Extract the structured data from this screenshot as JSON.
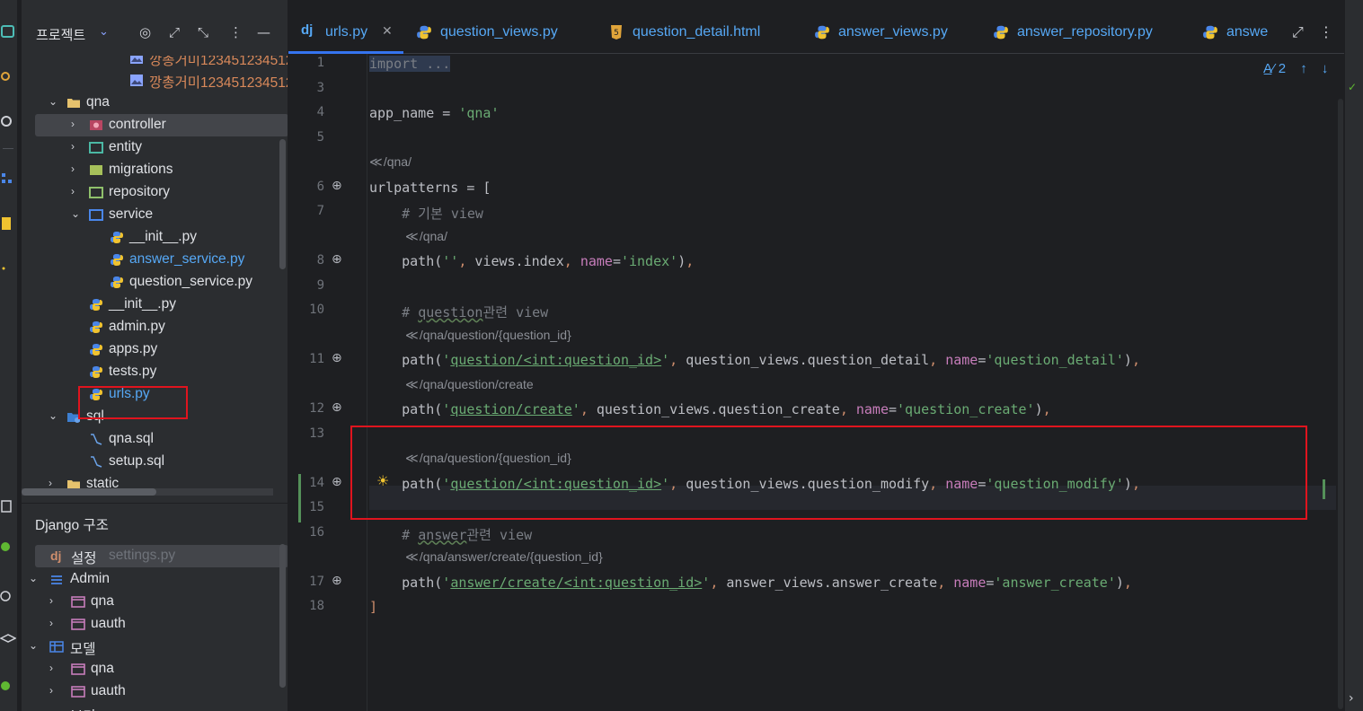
{
  "project_panel": {
    "title": "프로젝트",
    "tree": [
      {
        "label": "깡총거미1234512345123",
        "kind": "image",
        "depth": 4,
        "color": "#d9895a"
      },
      {
        "label": "깡총거미1234512345123",
        "kind": "image",
        "depth": 4,
        "color": "#d9895a"
      },
      {
        "label": "qna",
        "kind": "folder",
        "expanded": true
      },
      {
        "label": "controller",
        "kind": "package-controller",
        "expanded": false,
        "selected": true
      },
      {
        "label": "entity",
        "kind": "package-entity",
        "expanded": false
      },
      {
        "label": "migrations",
        "kind": "package-migrations",
        "expanded": false
      },
      {
        "label": "repository",
        "kind": "package-repository",
        "expanded": false
      },
      {
        "label": "service",
        "kind": "package-service",
        "expanded": true
      },
      {
        "label": "__init__.py",
        "kind": "python"
      },
      {
        "label": "answer_service.py",
        "kind": "python",
        "color": "#56a8f5"
      },
      {
        "label": "question_service.py",
        "kind": "python"
      },
      {
        "label": "__init__.py",
        "kind": "python"
      },
      {
        "label": "admin.py",
        "kind": "python"
      },
      {
        "label": "apps.py",
        "kind": "python"
      },
      {
        "label": "tests.py",
        "kind": "python"
      },
      {
        "label": "urls.py",
        "kind": "python",
        "color": "#56a8f5",
        "highlighted": true
      },
      {
        "label": "sql",
        "kind": "folder-sql",
        "expanded": true
      },
      {
        "label": "qna.sql",
        "kind": "sql"
      },
      {
        "label": "setup.sql",
        "kind": "sql"
      },
      {
        "label": "static",
        "kind": "folder",
        "expanded": false
      }
    ]
  },
  "django_panel": {
    "title": "Django 구조",
    "settings_label": "설정",
    "settings_file": "settings.py",
    "groups": [
      {
        "label": "Admin",
        "icon": "admin-icon",
        "items": [
          "qna",
          "uauth"
        ]
      },
      {
        "label": "모델",
        "icon": "table-icon",
        "items": [
          "qna",
          "uauth"
        ]
      }
    ],
    "bottom_item": "보기"
  },
  "tabs": [
    {
      "label": "urls.py",
      "icon": "dj",
      "active": true
    },
    {
      "label": "question_views.py",
      "icon": "python"
    },
    {
      "label": "question_detail.html",
      "icon": "html5"
    },
    {
      "label": "answer_views.py",
      "icon": "python"
    },
    {
      "label": "answer_repository.py",
      "icon": "python"
    },
    {
      "label": "answe",
      "icon": "python"
    }
  ],
  "inspection": {
    "count": "2"
  },
  "code_lines": [
    {
      "no": "1",
      "text": "import ...",
      "folded": true
    },
    {
      "no": "3",
      "text": ""
    },
    {
      "no": "4",
      "text": "app_name = 'qna'"
    },
    {
      "no": "5",
      "text": ""
    },
    {
      "hint": "/qna/"
    },
    {
      "no": "6",
      "text": "urlpatterns = [",
      "endpoint": true
    },
    {
      "no": "7",
      "text": "    # 기본 view"
    },
    {
      "hint": "/qna/"
    },
    {
      "no": "8",
      "text": "    path('', views.index, name='index'),",
      "endpoint": true
    },
    {
      "no": "9",
      "text": ""
    },
    {
      "no": "10",
      "text": "    # question관련 view"
    },
    {
      "hint": "/qna/question/{question_id}"
    },
    {
      "no": "11",
      "text": "    path('question/<int:question_id>', question_views.question_detail, name='question_detail'),",
      "endpoint": true
    },
    {
      "hint": "/qna/question/create"
    },
    {
      "no": "12",
      "text": "    path('question/create', question_views.question_create, name='question_create'),",
      "endpoint": true
    },
    {
      "no": "13",
      "text": ""
    },
    {
      "hint": "/qna/question/{question_id}"
    },
    {
      "no": "14",
      "text": "    path('question/<int:question_id>', question_views.question_modify, name='question_modify'),",
      "endpoint": true,
      "bulb": true
    },
    {
      "no": "15",
      "text": "",
      "current": true
    },
    {
      "no": "16",
      "text": "    # answer관련 view"
    },
    {
      "hint": "/qna/answer/create/{question_id}"
    },
    {
      "no": "17",
      "text": "    path('answer/create/<int:question_id>', answer_views.answer_create, name='answer_create'),",
      "endpoint": true
    },
    {
      "no": "18",
      "text": "]"
    }
  ]
}
